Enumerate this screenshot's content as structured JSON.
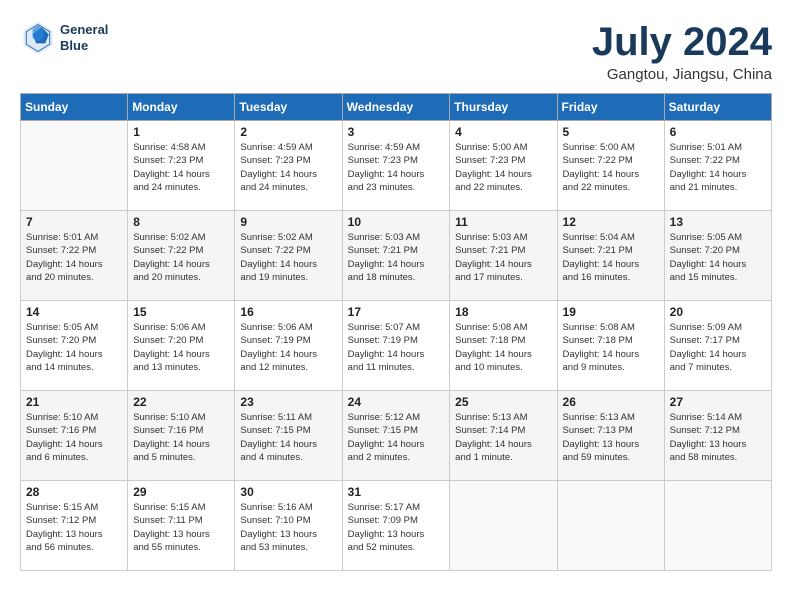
{
  "header": {
    "logo_line1": "General",
    "logo_line2": "Blue",
    "month_title": "July 2024",
    "location": "Gangtou, Jiangsu, China"
  },
  "weekdays": [
    "Sunday",
    "Monday",
    "Tuesday",
    "Wednesday",
    "Thursday",
    "Friday",
    "Saturday"
  ],
  "weeks": [
    [
      {
        "day": "",
        "info": ""
      },
      {
        "day": "1",
        "info": "Sunrise: 4:58 AM\nSunset: 7:23 PM\nDaylight: 14 hours\nand 24 minutes."
      },
      {
        "day": "2",
        "info": "Sunrise: 4:59 AM\nSunset: 7:23 PM\nDaylight: 14 hours\nand 24 minutes."
      },
      {
        "day": "3",
        "info": "Sunrise: 4:59 AM\nSunset: 7:23 PM\nDaylight: 14 hours\nand 23 minutes."
      },
      {
        "day": "4",
        "info": "Sunrise: 5:00 AM\nSunset: 7:23 PM\nDaylight: 14 hours\nand 22 minutes."
      },
      {
        "day": "5",
        "info": "Sunrise: 5:00 AM\nSunset: 7:22 PM\nDaylight: 14 hours\nand 22 minutes."
      },
      {
        "day": "6",
        "info": "Sunrise: 5:01 AM\nSunset: 7:22 PM\nDaylight: 14 hours\nand 21 minutes."
      }
    ],
    [
      {
        "day": "7",
        "info": "Sunrise: 5:01 AM\nSunset: 7:22 PM\nDaylight: 14 hours\nand 20 minutes."
      },
      {
        "day": "8",
        "info": "Sunrise: 5:02 AM\nSunset: 7:22 PM\nDaylight: 14 hours\nand 20 minutes."
      },
      {
        "day": "9",
        "info": "Sunrise: 5:02 AM\nSunset: 7:22 PM\nDaylight: 14 hours\nand 19 minutes."
      },
      {
        "day": "10",
        "info": "Sunrise: 5:03 AM\nSunset: 7:21 PM\nDaylight: 14 hours\nand 18 minutes."
      },
      {
        "day": "11",
        "info": "Sunrise: 5:03 AM\nSunset: 7:21 PM\nDaylight: 14 hours\nand 17 minutes."
      },
      {
        "day": "12",
        "info": "Sunrise: 5:04 AM\nSunset: 7:21 PM\nDaylight: 14 hours\nand 16 minutes."
      },
      {
        "day": "13",
        "info": "Sunrise: 5:05 AM\nSunset: 7:20 PM\nDaylight: 14 hours\nand 15 minutes."
      }
    ],
    [
      {
        "day": "14",
        "info": "Sunrise: 5:05 AM\nSunset: 7:20 PM\nDaylight: 14 hours\nand 14 minutes."
      },
      {
        "day": "15",
        "info": "Sunrise: 5:06 AM\nSunset: 7:20 PM\nDaylight: 14 hours\nand 13 minutes."
      },
      {
        "day": "16",
        "info": "Sunrise: 5:06 AM\nSunset: 7:19 PM\nDaylight: 14 hours\nand 12 minutes."
      },
      {
        "day": "17",
        "info": "Sunrise: 5:07 AM\nSunset: 7:19 PM\nDaylight: 14 hours\nand 11 minutes."
      },
      {
        "day": "18",
        "info": "Sunrise: 5:08 AM\nSunset: 7:18 PM\nDaylight: 14 hours\nand 10 minutes."
      },
      {
        "day": "19",
        "info": "Sunrise: 5:08 AM\nSunset: 7:18 PM\nDaylight: 14 hours\nand 9 minutes."
      },
      {
        "day": "20",
        "info": "Sunrise: 5:09 AM\nSunset: 7:17 PM\nDaylight: 14 hours\nand 7 minutes."
      }
    ],
    [
      {
        "day": "21",
        "info": "Sunrise: 5:10 AM\nSunset: 7:16 PM\nDaylight: 14 hours\nand 6 minutes."
      },
      {
        "day": "22",
        "info": "Sunrise: 5:10 AM\nSunset: 7:16 PM\nDaylight: 14 hours\nand 5 minutes."
      },
      {
        "day": "23",
        "info": "Sunrise: 5:11 AM\nSunset: 7:15 PM\nDaylight: 14 hours\nand 4 minutes."
      },
      {
        "day": "24",
        "info": "Sunrise: 5:12 AM\nSunset: 7:15 PM\nDaylight: 14 hours\nand 2 minutes."
      },
      {
        "day": "25",
        "info": "Sunrise: 5:13 AM\nSunset: 7:14 PM\nDaylight: 14 hours\nand 1 minute."
      },
      {
        "day": "26",
        "info": "Sunrise: 5:13 AM\nSunset: 7:13 PM\nDaylight: 13 hours\nand 59 minutes."
      },
      {
        "day": "27",
        "info": "Sunrise: 5:14 AM\nSunset: 7:12 PM\nDaylight: 13 hours\nand 58 minutes."
      }
    ],
    [
      {
        "day": "28",
        "info": "Sunrise: 5:15 AM\nSunset: 7:12 PM\nDaylight: 13 hours\nand 56 minutes."
      },
      {
        "day": "29",
        "info": "Sunrise: 5:15 AM\nSunset: 7:11 PM\nDaylight: 13 hours\nand 55 minutes."
      },
      {
        "day": "30",
        "info": "Sunrise: 5:16 AM\nSunset: 7:10 PM\nDaylight: 13 hours\nand 53 minutes."
      },
      {
        "day": "31",
        "info": "Sunrise: 5:17 AM\nSunset: 7:09 PM\nDaylight: 13 hours\nand 52 minutes."
      },
      {
        "day": "",
        "info": ""
      },
      {
        "day": "",
        "info": ""
      },
      {
        "day": "",
        "info": ""
      }
    ]
  ]
}
